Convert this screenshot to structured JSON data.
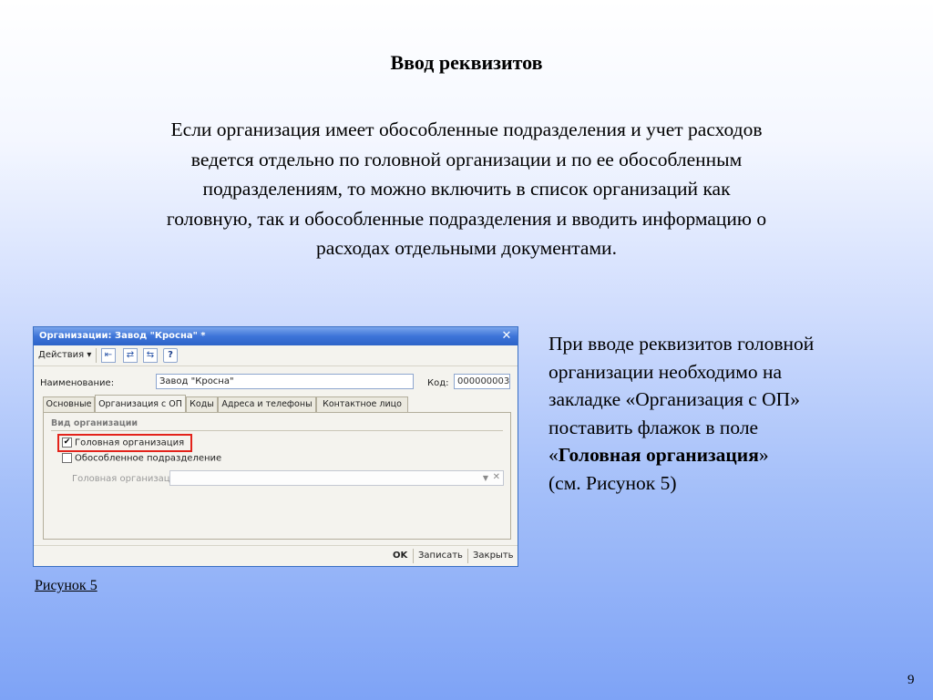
{
  "slide": {
    "title": "Ввод реквизитов",
    "intro_lines": [
      "Если организация имеет обособленные подразделения и учет расходов",
      "ведется отдельно по головной организации и по ее обособленным",
      "подразделениям, то можно включить в список организаций как",
      "головную, так и обособленные подразделения и вводить информацию о",
      "расходах отдельными документами."
    ],
    "side_lines": [
      "При вводе реквизитов головной",
      "организации необходимо на",
      "закладке  «Организация с ОП»",
      "поставить флажок в поле"
    ],
    "side_quote_open": "«",
    "side_bold": "Головная организация",
    "side_quote_close": "»",
    "side_ref": "(см. Рисунок 5)",
    "caption": "Рисунок 5",
    "page_number": "9"
  },
  "window": {
    "title": "Организации: Завод \"Кросна\" *",
    "close_glyph": "✕",
    "toolbar": {
      "actions_label": "Действия ▾",
      "btn1_glyph": "⇤",
      "btn2_glyph": "⇄",
      "btn3_glyph": "⇆",
      "help_glyph": "?"
    },
    "name_label": "Наименование:",
    "name_value": "Завод \"Кросна\"",
    "code_label": "Код:",
    "code_value": "000000003",
    "tabs": [
      "Основные",
      "Организация с ОП",
      "Коды",
      "Адреса и телефоны",
      "Контактное лицо"
    ],
    "group_title": "Вид организации",
    "checkbox_head": {
      "label": "Головная организация",
      "checked": "✔"
    },
    "checkbox_separate": {
      "label": "Обособленное подразделение",
      "checked": ""
    },
    "head_org_label": "Головная организация:",
    "head_org_value": "",
    "dropdown_glyph": "▼",
    "clear_glyph": "✕",
    "buttons": {
      "ok": "OK",
      "save": "Записать",
      "close": "Закрыть"
    }
  },
  "colors": {
    "highlight": "#e3231b",
    "titlebar": "#2d63c8"
  }
}
